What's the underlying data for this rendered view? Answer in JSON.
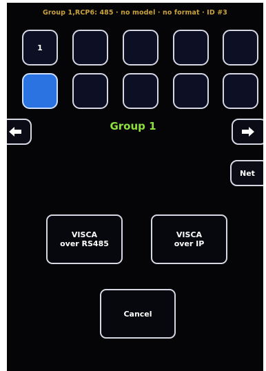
{
  "status_bar": "Group 1,RCP6: 485 · no model · no format · ID #3",
  "cameras": [
    "1",
    "",
    "",
    "",
    "",
    "",
    "",
    "",
    "",
    ""
  ],
  "selected_index": 5,
  "group_title": "Group 1",
  "prev_icon": "arrow-left-icon",
  "next_icon": "arrow-right-icon",
  "net_label": "Net",
  "visca_rs485_label": "VISCA\nover RS485",
  "visca_ip_label": "VISCA\nover IP",
  "cancel_label": "Cancel",
  "colors": {
    "background": "#050507",
    "status_text": "#c9a33a",
    "group_title": "#8ce13a",
    "selected_button": "#2a73e0",
    "button_border": "#d6d8e4"
  }
}
